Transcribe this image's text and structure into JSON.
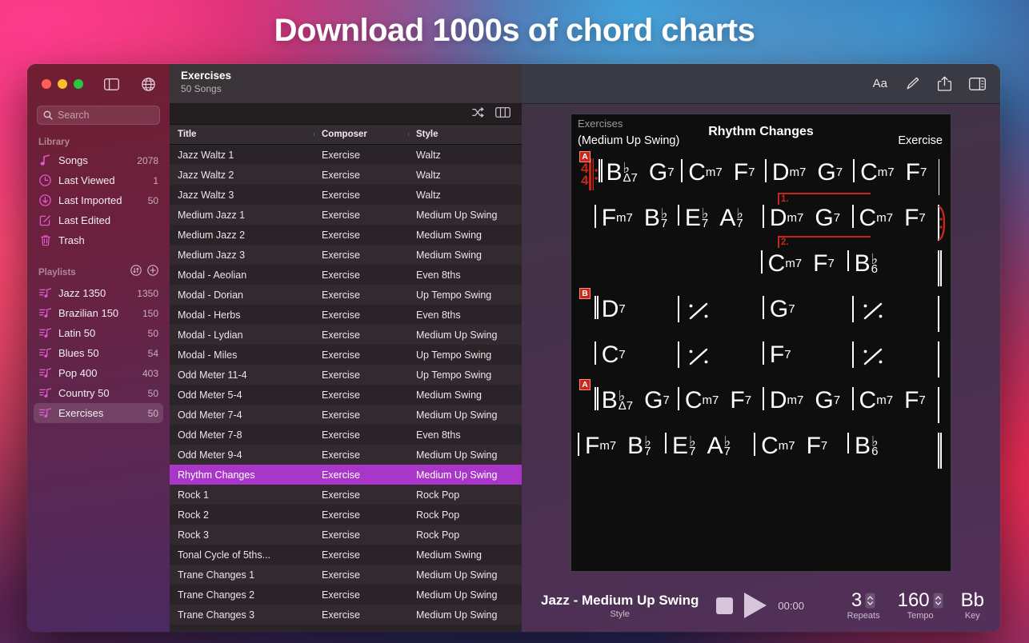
{
  "banner": {
    "text": "Download 1000s of chord charts"
  },
  "window": {
    "traffic": {
      "close": "close-button",
      "minimize": "minimize-button",
      "zoom": "zoom-button"
    },
    "toolbar_icons": [
      "sidebar-toggle-icon",
      "globe-icon"
    ]
  },
  "sidebar": {
    "search": {
      "placeholder": "Search"
    },
    "library_label": "Library",
    "library_items": [
      {
        "label": "Songs",
        "count": "2078",
        "icon": "music-note-icon"
      },
      {
        "label": "Last Viewed",
        "count": "1",
        "icon": "clock-icon"
      },
      {
        "label": "Last Imported",
        "count": "50",
        "icon": "download-circle-icon"
      },
      {
        "label": "Last Edited",
        "count": "",
        "icon": "pencil-square-icon"
      },
      {
        "label": "Trash",
        "count": "",
        "icon": "trash-icon"
      }
    ],
    "playlists_label": "Playlists",
    "playlists_icons": [
      "sort-icon",
      "add-icon"
    ],
    "playlists": [
      {
        "label": "Jazz 1350",
        "count": "1350",
        "selected": false
      },
      {
        "label": "Brazilian 150",
        "count": "150",
        "selected": false
      },
      {
        "label": "Latin 50",
        "count": "50",
        "selected": false
      },
      {
        "label": "Blues 50",
        "count": "54",
        "selected": false
      },
      {
        "label": "Pop 400",
        "count": "403",
        "selected": false
      },
      {
        "label": "Country 50",
        "count": "50",
        "selected": false
      },
      {
        "label": "Exercises",
        "count": "50",
        "selected": true
      }
    ]
  },
  "center": {
    "title": "Exercises",
    "subtitle": "50 Songs",
    "toolbar_icons": [
      "shuffle-icon",
      "column-view-icon"
    ],
    "columns": [
      "Title",
      "Composer",
      "Style"
    ],
    "rows": [
      {
        "title": "Jazz Waltz 1",
        "composer": "Exercise",
        "style": "Waltz",
        "selected": false
      },
      {
        "title": "Jazz Waltz 2",
        "composer": "Exercise",
        "style": "Waltz",
        "selected": false
      },
      {
        "title": "Jazz Waltz 3",
        "composer": "Exercise",
        "style": "Waltz",
        "selected": false
      },
      {
        "title": "Medium Jazz 1",
        "composer": "Exercise",
        "style": "Medium Up Swing",
        "selected": false
      },
      {
        "title": "Medium Jazz 2",
        "composer": "Exercise",
        "style": "Medium Swing",
        "selected": false
      },
      {
        "title": "Medium Jazz 3",
        "composer": "Exercise",
        "style": "Medium Swing",
        "selected": false
      },
      {
        "title": "Modal - Aeolian",
        "composer": "Exercise",
        "style": "Even 8ths",
        "selected": false
      },
      {
        "title": "Modal - Dorian",
        "composer": "Exercise",
        "style": "Up Tempo Swing",
        "selected": false
      },
      {
        "title": "Modal - Herbs",
        "composer": "Exercise",
        "style": "Even 8ths",
        "selected": false
      },
      {
        "title": "Modal - Lydian",
        "composer": "Exercise",
        "style": "Medium Up Swing",
        "selected": false
      },
      {
        "title": "Modal - Miles",
        "composer": "Exercise",
        "style": "Up Tempo Swing",
        "selected": false
      },
      {
        "title": "Odd Meter 11-4",
        "composer": "Exercise",
        "style": "Up Tempo Swing",
        "selected": false
      },
      {
        "title": "Odd Meter 5-4",
        "composer": "Exercise",
        "style": "Medium Swing",
        "selected": false
      },
      {
        "title": "Odd Meter 7-4",
        "composer": "Exercise",
        "style": "Medium Up Swing",
        "selected": false
      },
      {
        "title": "Odd Meter 7-8",
        "composer": "Exercise",
        "style": "Even 8ths",
        "selected": false
      },
      {
        "title": "Odd Meter 9-4",
        "composer": "Exercise",
        "style": "Medium Up Swing",
        "selected": false
      },
      {
        "title": "Rhythm Changes",
        "composer": "Exercise",
        "style": "Medium Up Swing",
        "selected": true
      },
      {
        "title": "Rock 1",
        "composer": "Exercise",
        "style": "Rock Pop",
        "selected": false
      },
      {
        "title": "Rock 2",
        "composer": "Exercise",
        "style": "Rock Pop",
        "selected": false
      },
      {
        "title": "Rock 3",
        "composer": "Exercise",
        "style": "Rock Pop",
        "selected": false
      },
      {
        "title": "Tonal Cycle of 5ths...",
        "composer": "Exercise",
        "style": "Medium Swing",
        "selected": false
      },
      {
        "title": "Trane Changes 1",
        "composer": "Exercise",
        "style": "Medium Up Swing",
        "selected": false
      },
      {
        "title": "Trane Changes 2",
        "composer": "Exercise",
        "style": "Medium Up Swing",
        "selected": false
      },
      {
        "title": "Trane Changes 3",
        "composer": "Exercise",
        "style": "Medium Up Swing",
        "selected": false
      }
    ]
  },
  "right": {
    "toolbar_icons": [
      "text-format-icon",
      "pencil-icon",
      "share-icon",
      "inspector-toggle-icon"
    ],
    "toolbar_aa": "Aa",
    "chart": {
      "playlist": "Exercises",
      "title": "Rhythm Changes",
      "style": "(Medium Up Swing)",
      "composer": "Exercise",
      "time_signature": {
        "top": "4",
        "bottom": "4"
      },
      "sections": [
        {
          "mark": "A"
        },
        {
          "mark": "B"
        },
        {
          "mark": "A"
        }
      ],
      "endings": [
        "1.",
        "2."
      ],
      "lines": [
        {
          "measures": [
            {
              "chords": [
                {
                  "root": "B",
                  "flat": "b",
                  "qual": "Δ7"
                },
                {
                  "root": "G",
                  "sub": "7"
                }
              ]
            },
            {
              "chords": [
                {
                  "root": "C",
                  "sub": "m7"
                },
                {
                  "root": "F",
                  "sub": "7"
                }
              ]
            },
            {
              "chords": [
                {
                  "root": "D",
                  "sub": "m7"
                },
                {
                  "root": "G",
                  "sub": "7"
                }
              ]
            },
            {
              "chords": [
                {
                  "root": "C",
                  "sub": "m7"
                },
                {
                  "root": "F",
                  "sub": "7"
                }
              ]
            }
          ]
        },
        {
          "measures": [
            {
              "chords": [
                {
                  "root": "F",
                  "sub": "m7"
                },
                {
                  "root": "B",
                  "flat": "b",
                  "qual": "7"
                }
              ]
            },
            {
              "chords": [
                {
                  "root": "E",
                  "flat": "b",
                  "qual": "7"
                },
                {
                  "root": "A",
                  "flat": "b",
                  "qual": "7"
                }
              ]
            },
            {
              "chords": [
                {
                  "root": "D",
                  "sub": "m7"
                },
                {
                  "root": "G",
                  "sub": "7"
                }
              ]
            },
            {
              "chords": [
                {
                  "root": "C",
                  "sub": "m7"
                },
                {
                  "root": "F",
                  "sub": "7"
                }
              ]
            }
          ]
        },
        {
          "measures": [
            {
              "chords": [
                {
                  "root": "C",
                  "sub": "m7"
                },
                {
                  "root": "F",
                  "sub": "7"
                }
              ]
            },
            {
              "chords": [
                {
                  "root": "B",
                  "flat": "b",
                  "qual": "6"
                }
              ]
            }
          ]
        },
        {
          "measures": [
            {
              "chords": [
                {
                  "root": "D",
                  "sub": "7"
                }
              ]
            },
            {
              "chords": [
                {
                  "simile": "⁄"
                }
              ]
            },
            {
              "chords": [
                {
                  "root": "G",
                  "sub": "7"
                }
              ]
            },
            {
              "chords": [
                {
                  "simile": "⁄"
                }
              ]
            }
          ]
        },
        {
          "measures": [
            {
              "chords": [
                {
                  "root": "C",
                  "sub": "7"
                }
              ]
            },
            {
              "chords": [
                {
                  "simile": "⁄"
                }
              ]
            },
            {
              "chords": [
                {
                  "root": "F",
                  "sub": "7"
                }
              ]
            },
            {
              "chords": [
                {
                  "simile": "⁄"
                }
              ]
            }
          ]
        },
        {
          "measures": [
            {
              "chords": [
                {
                  "root": "B",
                  "flat": "b",
                  "qual": "Δ7"
                },
                {
                  "root": "G",
                  "sub": "7"
                }
              ]
            },
            {
              "chords": [
                {
                  "root": "C",
                  "sub": "m7"
                },
                {
                  "root": "F",
                  "sub": "7"
                }
              ]
            },
            {
              "chords": [
                {
                  "root": "D",
                  "sub": "m7"
                },
                {
                  "root": "G",
                  "sub": "7"
                }
              ]
            },
            {
              "chords": [
                {
                  "root": "C",
                  "sub": "m7"
                },
                {
                  "root": "F",
                  "sub": "7"
                }
              ]
            }
          ]
        },
        {
          "measures": [
            {
              "chords": [
                {
                  "root": "F",
                  "sub": "m7"
                },
                {
                  "root": "B",
                  "flat": "b",
                  "qual": "7"
                }
              ]
            },
            {
              "chords": [
                {
                  "root": "E",
                  "flat": "b",
                  "qual": "7"
                },
                {
                  "root": "A",
                  "flat": "b",
                  "qual": "7"
                }
              ]
            },
            {
              "chords": [
                {
                  "root": "C",
                  "sub": "m7"
                },
                {
                  "root": "F",
                  "sub": "7"
                }
              ]
            },
            {
              "chords": [
                {
                  "root": "B",
                  "flat": "b",
                  "qual": "6"
                }
              ]
            }
          ]
        }
      ]
    }
  },
  "player": {
    "style_name": "Jazz - Medium Up Swing",
    "style_caption": "Style",
    "stop_label": "stop-button",
    "play_label": "play-button",
    "time": "00:00",
    "repeats_value": "3",
    "repeats_caption": "Repeats",
    "tempo_value": "160",
    "tempo_caption": "Tempo",
    "key_value": "Bb",
    "key_caption": "Key"
  },
  "colors": {
    "selection": "#a936c9",
    "accent_pink": "#e05ad0",
    "section_red": "#c8261b",
    "chart_bg": "#0e0e0e"
  }
}
